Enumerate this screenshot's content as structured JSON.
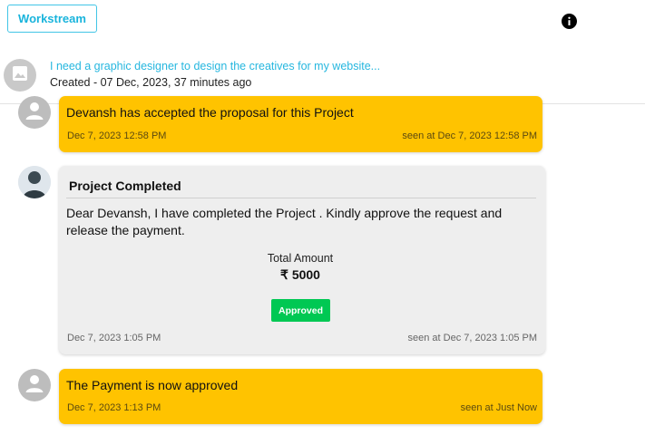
{
  "header": {
    "workstream_label": "Workstream",
    "project_title": "I need a graphic designer to design the creatives for my website...",
    "created_text": "Created - 07 Dec, 2023, 37 minutes ago"
  },
  "icons": {
    "info": "info-icon",
    "image_placeholder": "image-icon",
    "user_placeholder": "user-icon"
  },
  "colors": {
    "accent": "#19b4dc",
    "message_yellow": "#ffc300",
    "card_grey": "#eeeeee",
    "approved_green": "#00c853"
  },
  "messages": [
    {
      "text": "Devansh has accepted the proposal for this Project",
      "time": "Dec 7, 2023 12:58 PM",
      "seen": "seen at Dec 7, 2023 12:58 PM"
    },
    {
      "title": "Project Completed",
      "text": "Dear Devansh, I have completed the Project . Kindly approve the request and release the payment.",
      "amount_label": "Total Amount",
      "amount": "₹ 5000",
      "status": "Approved",
      "time": "Dec 7, 2023 1:05 PM",
      "seen": "seen at Dec 7, 2023 1:05 PM"
    },
    {
      "text": "The Payment is now approved",
      "time": "Dec 7, 2023 1:13 PM",
      "seen": "seen at Just Now"
    }
  ]
}
